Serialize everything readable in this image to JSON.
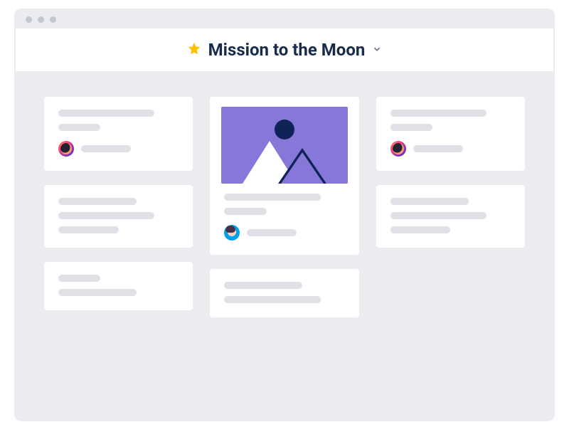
{
  "header": {
    "title": "Mission to the Moon",
    "star_icon": "star-icon",
    "dropdown_icon": "chevron-down-icon"
  },
  "columns": [
    {
      "cards": [
        {
          "type": "text-avatar",
          "avatar": "gradient"
        },
        {
          "type": "text3"
        },
        {
          "type": "text2"
        }
      ]
    },
    {
      "cards": [
        {
          "type": "image-text-avatar",
          "avatar": "blue"
        },
        {
          "type": "text2b"
        }
      ]
    },
    {
      "cards": [
        {
          "type": "text-avatar",
          "avatar": "gradient"
        },
        {
          "type": "text3"
        }
      ]
    }
  ]
}
